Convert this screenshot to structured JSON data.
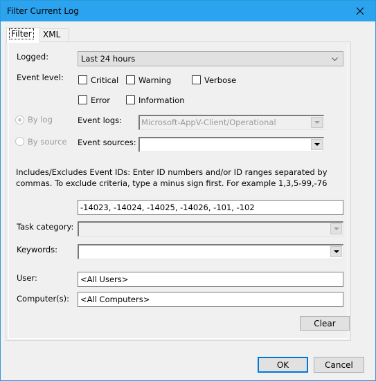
{
  "window": {
    "title": "Filter Current Log",
    "close_icon": "close-icon"
  },
  "tabs": [
    {
      "label": "Filter",
      "active": true
    },
    {
      "label": "XML",
      "active": false
    }
  ],
  "filter": {
    "logged": {
      "label": "Logged:",
      "value": "Last 24 hours"
    },
    "event_level": {
      "label": "Event level:",
      "options": [
        {
          "label": "Critical",
          "checked": false
        },
        {
          "label": "Warning",
          "checked": false
        },
        {
          "label": "Verbose",
          "checked": false
        },
        {
          "label": "Error",
          "checked": false
        },
        {
          "label": "Information",
          "checked": false
        }
      ]
    },
    "by_log": {
      "label": "By log",
      "selected": true,
      "enabled": false
    },
    "by_source": {
      "label": "By source",
      "selected": false,
      "enabled": false
    },
    "event_logs": {
      "label": "Event logs:",
      "value": "Microsoft-AppV-Client/Operational"
    },
    "event_sources": {
      "label": "Event sources:",
      "value": ""
    },
    "event_ids": {
      "description": "Includes/Excludes Event IDs: Enter ID numbers and/or ID ranges separated by commas. To exclude criteria, type a minus sign first. For example 1,3,5-99,-76",
      "value": "-14023, -14024, -14025, -14026, -101, -102"
    },
    "task_category": {
      "label": "Task category:",
      "value": ""
    },
    "keywords": {
      "label": "Keywords:",
      "value": ""
    },
    "user": {
      "label": "User:",
      "value": "<All Users>"
    },
    "computers": {
      "label": "Computer(s):",
      "value": "<All Computers>"
    },
    "clear_label": "Clear"
  },
  "footer": {
    "ok_label": "OK",
    "cancel_label": "Cancel"
  }
}
